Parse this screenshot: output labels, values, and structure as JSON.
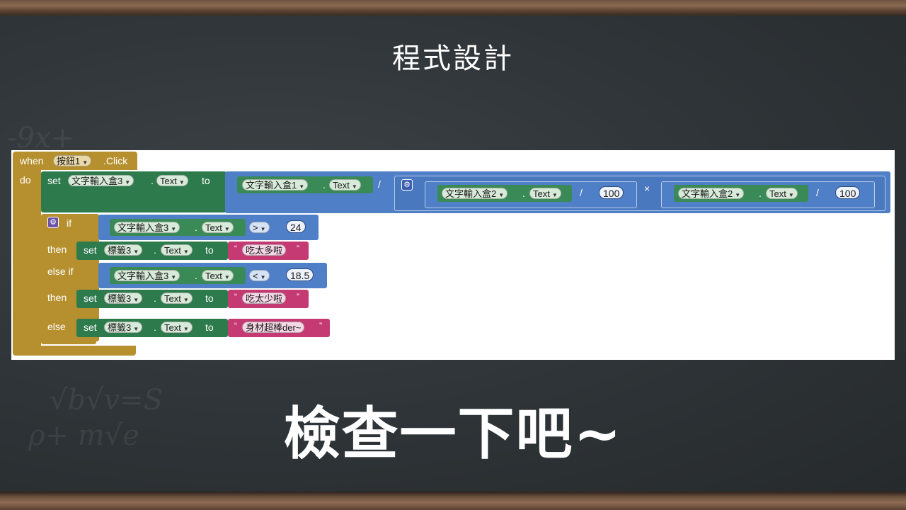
{
  "slide": {
    "title": "程式設計",
    "caption": "檢查一下吧~"
  },
  "blocks": {
    "when": "when",
    "component": "按鈕1",
    "event": ".Click",
    "do": "do",
    "set": "set",
    "to": "to",
    "dot": ".",
    "text": "Text",
    "if": "if",
    "then": "then",
    "else_if": "else if",
    "else": "else",
    "textbox1": "文字輸入盒1",
    "textbox2": "文字輸入盒2",
    "textbox3": "文字輸入盒3",
    "label3": "標籤3",
    "op_divide": "/",
    "op_multiply": "×",
    "op_gt": ">",
    "op_lt": "<",
    "num_100": "100",
    "num_24": "24",
    "num_18_5": "18.5",
    "msg_too_much": "吃太多啦",
    "msg_too_little": "吃太少啦",
    "msg_great": "身材超棒der~",
    "quote_open": "“",
    "quote_close": "”"
  },
  "colors": {
    "event_block": "#b6902f",
    "setter_block": "#2d7a4d",
    "math_block": "#4f7fc7",
    "text_block": "#c53a72"
  }
}
